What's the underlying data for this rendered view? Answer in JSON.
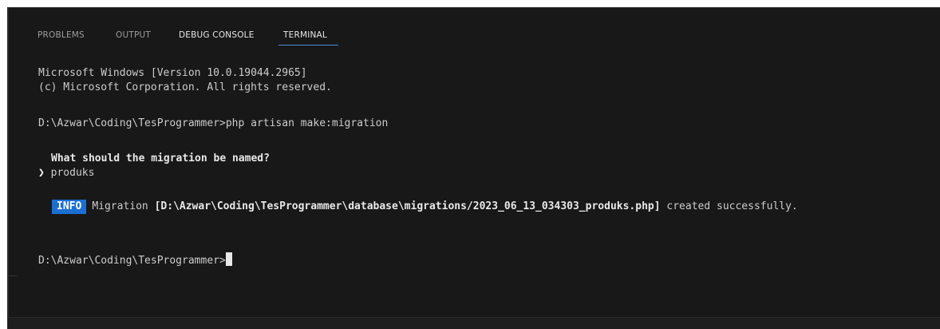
{
  "tabs": [
    {
      "label": "PROBLEMS",
      "active": false
    },
    {
      "label": "OUTPUT",
      "active": false
    },
    {
      "label": "DEBUG CONSOLE",
      "active": false
    },
    {
      "label": "TERMINAL",
      "active": true
    }
  ],
  "terminal": {
    "line1": "Microsoft Windows [Version 10.0.19044.2965]",
    "line2": "(c) Microsoft Corporation. All rights reserved.",
    "command_prompt": "D:\\Azwar\\Coding\\TesProgrammer>",
    "command": "php artisan make:migration",
    "question": "What should the migration be named?",
    "answer_arrow": "❯",
    "answer": "produks",
    "info_badge": "INFO",
    "info_prefix": "Migration ",
    "info_path": "[D:\\Azwar\\Coding\\TesProgrammer\\database\\migrations/2023_06_13_034303_produks.php]",
    "info_suffix": " created successfully.",
    "final_prompt": "D:\\Azwar\\Coding\\TesProgrammer>"
  },
  "colors": {
    "background": "#181818",
    "active_tab_underline": "#4a8ad0",
    "info_badge": "#1a6fd4"
  }
}
